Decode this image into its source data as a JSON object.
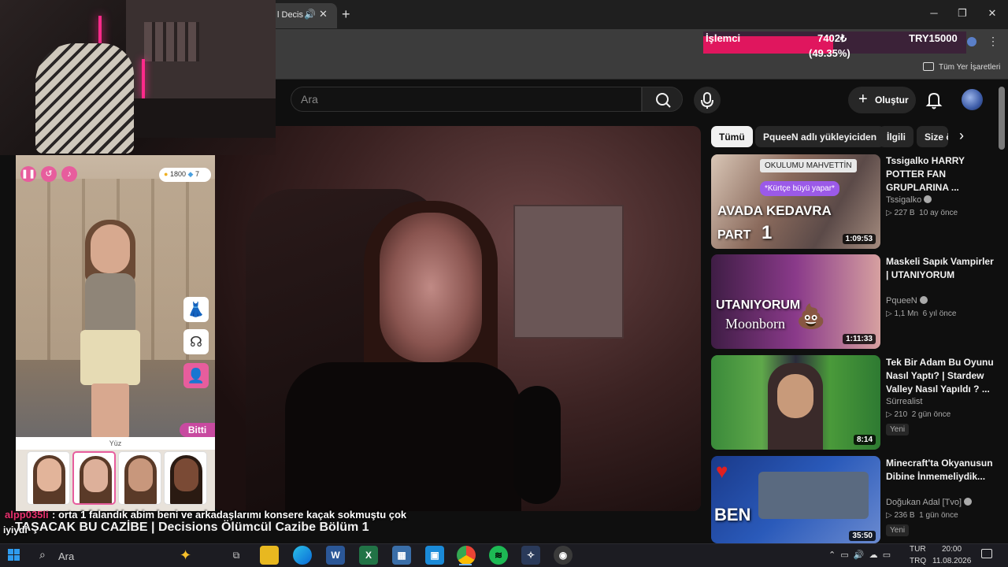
{
  "browser": {
    "tab_title": "l Decis",
    "new_tab": "+",
    "window_controls": {
      "minimize": "─",
      "maximize": "❐",
      "close": "✕"
    },
    "bookmarks_all": "Tüm Yer İşaretleri"
  },
  "overlay_stat": {
    "label": "İşlemci",
    "value": "7402₺",
    "percent_text": "(49.35%)",
    "progress": 0.4935,
    "target": "TRY15000",
    "fill_color": "#e0165e"
  },
  "youtube": {
    "search_placeholder": "Ara",
    "create_label": "Oluştur",
    "video_title": "TAŞACAK BU CAZİBE | Decisions Ölümcül Cazibe Bölüm 1",
    "chips": [
      "Tümü",
      "PqueeN adlı yükleyiciden",
      "İlgili",
      "Size ö"
    ],
    "related": [
      {
        "title": "Tssigalko HARRY POTTER FAN GRUPLARINA ...",
        "channel": "Tssigalko",
        "views": "▷ 227 B",
        "age": "10 ay önce",
        "duration": "1:09:53",
        "thumb_text_1": "OKULUMU MAHVETTİN",
        "thumb_text_2": "*Kürtçe büyü yapar*",
        "thumb_text_3": "AVADA KEDAVRA",
        "thumb_text_4": "PART",
        "thumb_text_5": "1"
      },
      {
        "title": "Maskeli Sapık Vampirler | UTANIYORUM",
        "channel": "PqueeN",
        "views": "▷ 1,1 Mn",
        "age": "6 yıl önce",
        "duration": "1:11:33",
        "thumb_text_1": "UTANIYORUM",
        "thumb_text_2": "Moonborn"
      },
      {
        "title": "Tek Bir Adam Bu Oyunu Nasıl Yaptı? | Stardew Valley Nasıl Yapıldı ? ...",
        "channel": "Sürrealist",
        "views": "▷ 210",
        "age": "2 gün önce",
        "duration": "8:14",
        "badge": "Yeni"
      },
      {
        "title": "Minecraft'ta Okyanusun Dibine İnmemeliydik...",
        "channel": "Doğukan Adal [Tvo]",
        "views": "▷ 236 B",
        "age": "1 gün önce",
        "duration": "35:50",
        "badge": "Yeni",
        "thumb_text_1": "BEN"
      }
    ]
  },
  "game": {
    "currency": "1800",
    "gems": "7",
    "panel_title": "Yüz",
    "done_label": "Bitti"
  },
  "chat": {
    "user": "alpp035li",
    "message": ": orta 1 falandık abim beni ve arkadaşlarımı konsere kaçak sokmuştu çok",
    "message_cont": "iyiydi"
  },
  "taskbar": {
    "search_label": "Ara",
    "lang_1": "TUR",
    "lang_2": "TRQ",
    "time": "20:00",
    "date": "11.08.2026"
  }
}
